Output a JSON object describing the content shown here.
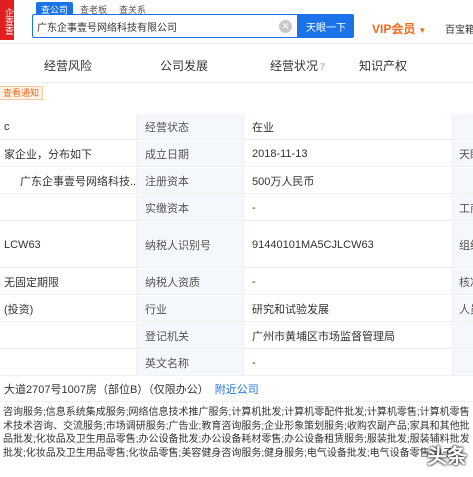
{
  "header": {
    "logo_text": "企查查",
    "mode_tabs": [
      "查公司",
      "查老板",
      "查关系"
    ],
    "search": {
      "value": "广东企事壹号网络科技有限公司",
      "placeholder": ""
    },
    "search_button": "天眼一下",
    "vip_label": "VIP会员",
    "extra_link": "百宝箱"
  },
  "nav": {
    "items": [
      {
        "label": "经营风险"
      },
      {
        "label": "公司发展"
      },
      {
        "label": "经营状况",
        "count": "7"
      },
      {
        "label": "知识产权"
      }
    ]
  },
  "notice": "查看通知",
  "left_column": {
    "row1": "c",
    "row2": "家企业，分布如下",
    "row3": "广东企事壹号网络科技...",
    "row6": "LCW63",
    "row7": "无固定期限",
    "row8": "(投资)"
  },
  "info": {
    "rows": [
      {
        "label": "经营状态",
        "value": "在业",
        "edge": ""
      },
      {
        "label": "成立日期",
        "value": "2018-11-13",
        "edge": "天眼"
      },
      {
        "label": "注册资本",
        "value": "500万人民币",
        "edge": ""
      },
      {
        "label": "实缴资本",
        "value": "-",
        "edge": "工商"
      },
      {
        "label": "纳税人识别号",
        "value": "91440101MA5CJLCW63",
        "edge": "组织"
      },
      {
        "label": "纳税人资质",
        "value": "-",
        "edge": "核准"
      },
      {
        "label": "行业",
        "value": "研究和试验发展",
        "edge": "人员"
      },
      {
        "label": "登记机关",
        "value": "广州市黄埔区市场监督管理局",
        "edge": ""
      },
      {
        "label": "英文名称",
        "value": "-",
        "edge": ""
      }
    ]
  },
  "address": {
    "text": "大道2707号1007房（部位B）（仅限办公）",
    "link": "附近公司"
  },
  "scope": [
    "咨询服务;信息系统集成服务;网络信息技术推广服务;计算机批发;计算机零配件批发;计算机零售;计算机零售",
    "术技术咨询、交流服务;市场调研服务;广告业;教育咨询服务;企业形象策划服务;收购农副产品;家具和其他批",
    "品批发;化妆品及卫生用品零售;办公设备批发;办公设备耗材零售;办公设备租赁服务;服装批发;服装辅料批发",
    "批发;化妆品及卫生用品零售;化妆品零售;美容健身咨询服务;健身服务;电气设备批发;电气设备零售;电子"
  ],
  "watermark": "头条"
}
